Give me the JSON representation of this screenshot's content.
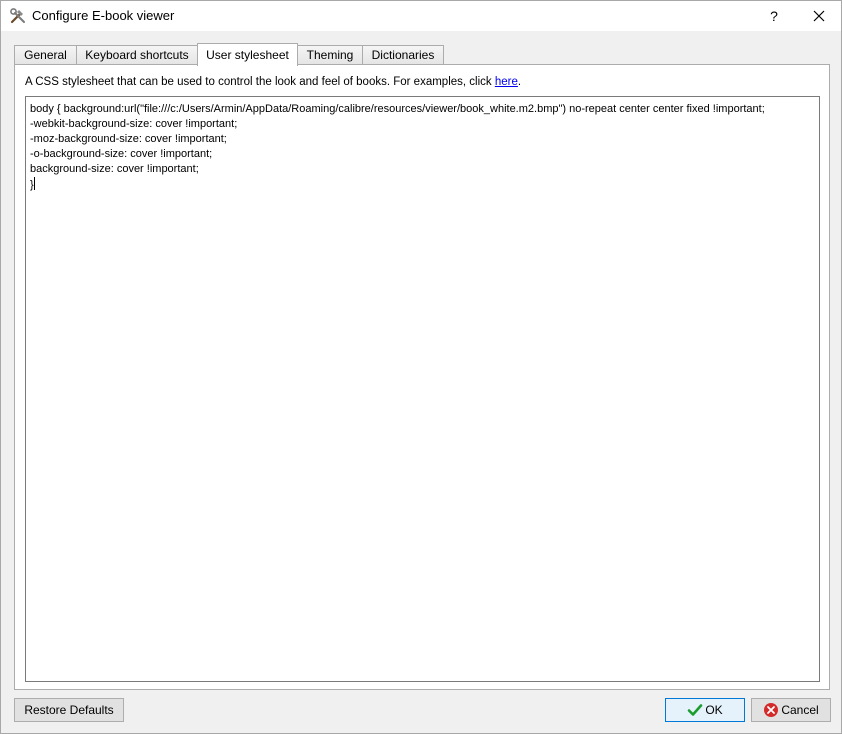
{
  "window": {
    "title": "Configure E-book viewer",
    "help_label": "?"
  },
  "tabs": [
    {
      "label": "General",
      "active": false
    },
    {
      "label": "Keyboard shortcuts",
      "active": false
    },
    {
      "label": "User stylesheet",
      "active": true
    },
    {
      "label": "Theming",
      "active": false
    },
    {
      "label": "Dictionaries",
      "active": false
    }
  ],
  "panel": {
    "description": "A CSS stylesheet that can be used to control the look and feel of books. For examples, click ",
    "link_text": "here",
    "description_end": ".",
    "stylesheet_text": "body { background:url(\"file:///c:/Users/Armin/AppData/Roaming/calibre/resources/viewer/book_white.m2.bmp\") no-repeat center center fixed !important;\n-webkit-background-size: cover !important;\n-moz-background-size: cover !important;\n-o-background-size: cover !important;\nbackground-size: cover !important;\n}"
  },
  "buttons": {
    "restore_defaults": "Restore Defaults",
    "ok": "OK",
    "cancel": "Cancel"
  },
  "icons": {
    "app": "tools-icon",
    "close": "close-icon",
    "ok": "checkmark-icon",
    "cancel": "cancel-icon"
  },
  "colors": {
    "link": "#0000ee",
    "ok_check": "#1a9c2e",
    "cancel_circle": "#d42a2a",
    "default_button_border": "#0078d7"
  }
}
